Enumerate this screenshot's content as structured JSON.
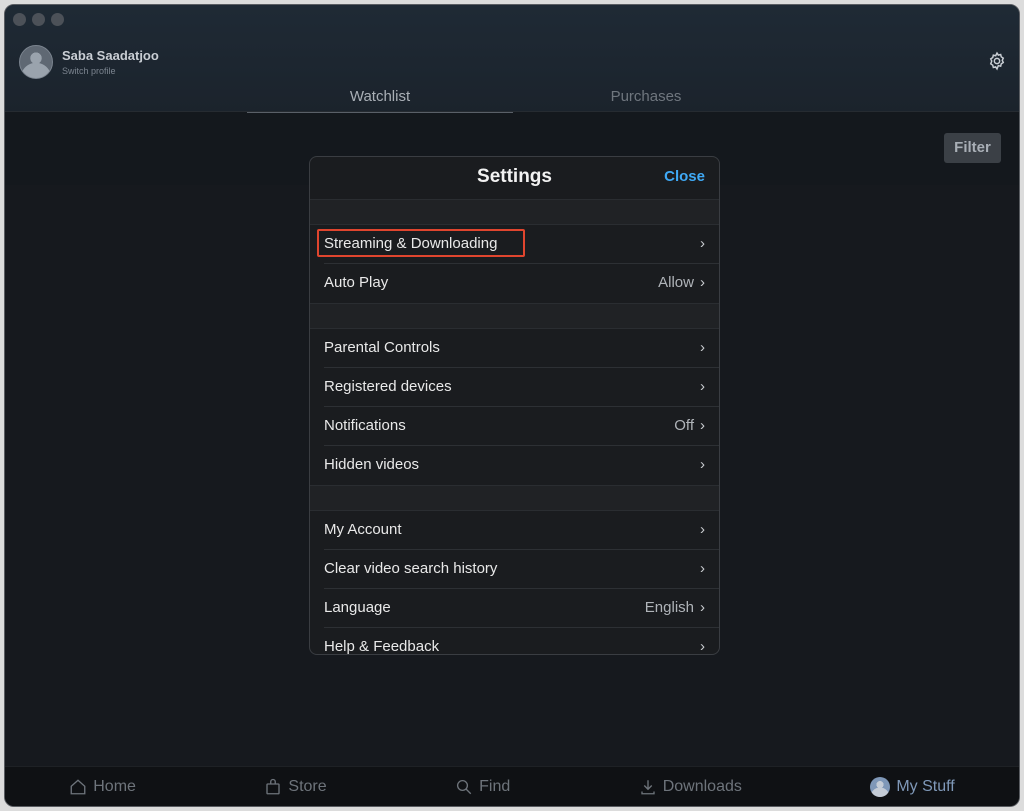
{
  "profile": {
    "name": "Saba Saadatjoo",
    "subtitle": "Switch profile"
  },
  "tabs": [
    {
      "label": "Watchlist",
      "active": true
    },
    {
      "label": "Purchases",
      "active": false
    }
  ],
  "filter_label": "Filter",
  "settings": {
    "title": "Settings",
    "close_label": "Close",
    "groups": [
      [
        {
          "label": "Streaming & Downloading",
          "value": "",
          "highlighted": true
        },
        {
          "label": "Auto Play",
          "value": "Allow"
        }
      ],
      [
        {
          "label": "Parental Controls",
          "value": ""
        },
        {
          "label": "Registered devices",
          "value": ""
        },
        {
          "label": "Notifications",
          "value": "Off"
        },
        {
          "label": "Hidden videos",
          "value": ""
        }
      ],
      [
        {
          "label": "My Account",
          "value": ""
        },
        {
          "label": "Clear video search history",
          "value": ""
        },
        {
          "label": "Language",
          "value": "English"
        },
        {
          "label": "Help & Feedback",
          "value": ""
        }
      ]
    ]
  },
  "bottom_nav": [
    {
      "label": "Home",
      "icon": "home-icon"
    },
    {
      "label": "Store",
      "icon": "store-icon"
    },
    {
      "label": "Find",
      "icon": "search-icon"
    },
    {
      "label": "Downloads",
      "icon": "download-icon"
    },
    {
      "label": "My Stuff",
      "icon": "avatar-icon",
      "active": true
    }
  ],
  "colors": {
    "accent": "#3fa9f5",
    "highlight": "#e0452e",
    "active_nav": "#7f98b8"
  }
}
